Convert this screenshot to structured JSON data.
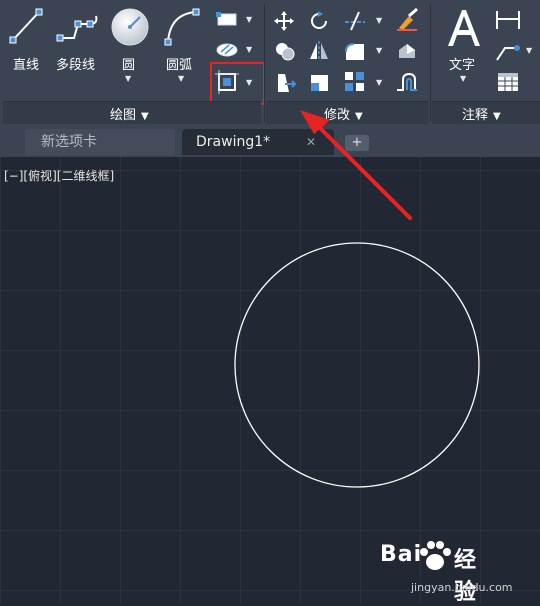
{
  "ribbon": {
    "draw_panel": {
      "title": "绘图",
      "tools": [
        "直线",
        "多段线",
        "圆",
        "圆弧"
      ]
    },
    "modify_panel": {
      "title": "修改"
    },
    "annotate_panel": {
      "title": "注释",
      "tools": [
        "文字"
      ]
    },
    "panel_dropdown_glyph": "▼"
  },
  "tabs": {
    "inactive_label": "新选项卡",
    "active_label": "Drawing1*",
    "close_glyph": "✕",
    "add_glyph": "+"
  },
  "viewport": {
    "label": "[−][俯视][二维线框]"
  },
  "watermark": {
    "brand": "Bai",
    "brand2": "经验",
    "url": "jingyan.baidu.com"
  },
  "colors": {
    "ribbon_bg": "#3b4453",
    "canvas_bg": "#222833",
    "highlight": "#e52524",
    "arrow": "#e52524",
    "accent_icon": "#4a90d9"
  },
  "icons": [
    "line-icon",
    "polyline-icon",
    "circle-icon",
    "arc-icon",
    "rectangle-icon",
    "hatch-icon",
    "boundary-icon",
    "move-icon",
    "rotate-icon",
    "trim-icon",
    "erase-icon",
    "copy-icon",
    "mirror-icon",
    "fillet-icon",
    "explode-icon",
    "stretch-icon",
    "scale-icon",
    "array-icon",
    "offset-icon",
    "text-icon",
    "dimension-icon",
    "leader-icon",
    "table-icon"
  ]
}
